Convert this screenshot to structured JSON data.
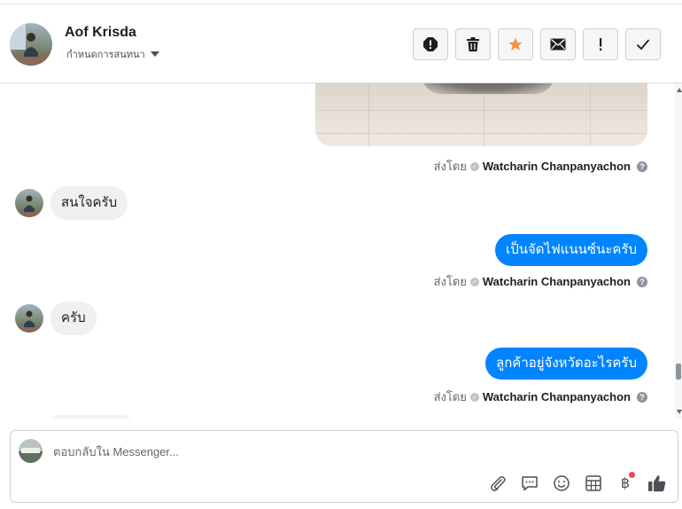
{
  "header": {
    "name": "Aof Krisda",
    "subtitle": "กำหนดการสนทนา"
  },
  "toolbar": {
    "buttons": [
      {
        "name": "spam-button",
        "icon": "alert-octagon-icon"
      },
      {
        "name": "delete-button",
        "icon": "trash-icon"
      },
      {
        "name": "star-button",
        "icon": "star-icon",
        "color": "#f7923b"
      },
      {
        "name": "mark-unread-button",
        "icon": "envelope-icon"
      },
      {
        "name": "follow-up-button",
        "icon": "exclamation-icon"
      },
      {
        "name": "mark-done-button",
        "icon": "checkmark-icon"
      }
    ]
  },
  "thread": {
    "sent_by_prefix": "ส่งโดย",
    "sender": "Watcharin Chanpanyachon",
    "messages": [
      {
        "direction": "in",
        "text": "สนใจครับ"
      },
      {
        "direction": "out",
        "text": "เป็นจัดไฟแนนซ์นะครับ"
      },
      {
        "direction": "in",
        "text": "ครับ"
      },
      {
        "direction": "out",
        "text": "ลูกค้าอยู่จังหวัดอะไรครับ"
      }
    ]
  },
  "composer": {
    "placeholder": "ตอบกลับใน Messenger...",
    "tools": [
      "paperclip-icon",
      "saved-reply-icon",
      "emoji-icon",
      "template-icon",
      "baht-payment-icon",
      "thumbs-up-icon"
    ],
    "accent_color": "#0084ff"
  }
}
